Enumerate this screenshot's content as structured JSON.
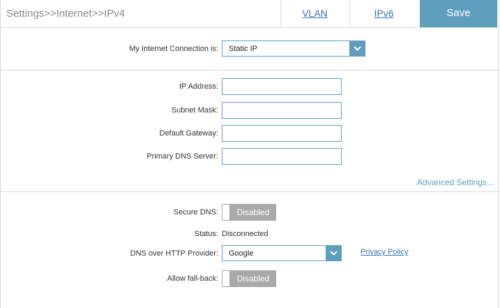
{
  "header": {
    "breadcrumb": "Settings>>Internet>>IPv4",
    "tabs": [
      {
        "label": "VLAN"
      },
      {
        "label": "IPv6"
      }
    ],
    "save_label": "Save"
  },
  "connection": {
    "label": "My Internet Connection is:",
    "value": "Static IP"
  },
  "static_ip": {
    "fields": [
      {
        "label": "IP Address:",
        "value": ""
      },
      {
        "label": "Subnet Mask:",
        "value": ""
      },
      {
        "label": "Default Gateway:",
        "value": ""
      },
      {
        "label": "Primary DNS Server:",
        "value": ""
      }
    ],
    "advanced_link": "Advanced Settings..."
  },
  "dns": {
    "secure_dns_label": "Secure DNS:",
    "secure_dns_state": "Disabled",
    "status_label": "Status:",
    "status_value": "Disconnected",
    "provider_label": "DNS over HTTP Provider:",
    "provider_value": "Google",
    "privacy_link": "Privacy Policy",
    "fallback_label": "Allow fall-back:",
    "fallback_state": "Disabled"
  },
  "colors": {
    "accent": "#5e9fbe",
    "link": "#3d6fb5",
    "toggle_off": "#a9a9a9"
  },
  "icons": {
    "dropdown": "chevron-down-icon"
  }
}
